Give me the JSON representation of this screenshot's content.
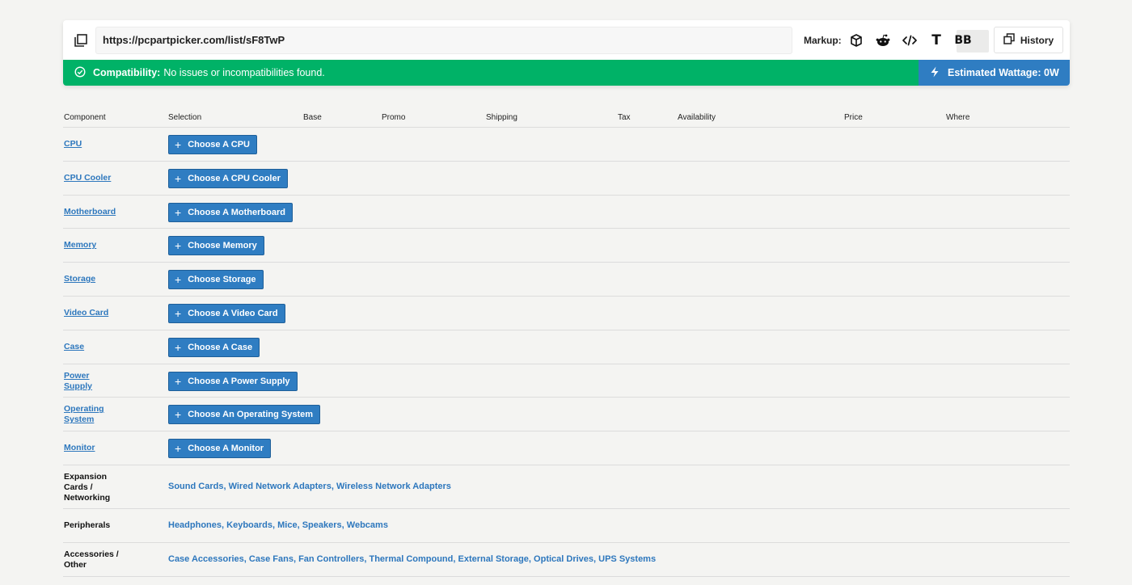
{
  "url": "https://pcpartpicker.com/list/sF8TwP",
  "markup": {
    "label": "Markup:",
    "icons": [
      "cube-icon",
      "reddit-icon",
      "code-icon",
      "text-t-icon",
      "bbcode-icon"
    ],
    "text_icon_glyph": "T",
    "bb_glyph": "BB"
  },
  "history_label": "History",
  "compatibility": {
    "label": "Compatibility:",
    "message": "No issues or incompatibilities found.",
    "color": "#00b267"
  },
  "wattage": {
    "label": "Estimated Wattage: 0W",
    "color": "#2f7dc2"
  },
  "columns": [
    "Component",
    "Selection",
    "Base",
    "Promo",
    "Shipping",
    "Tax",
    "Availability",
    "Price",
    "Where"
  ],
  "components": [
    {
      "name": "CPU",
      "button": "Choose A CPU"
    },
    {
      "name": "CPU Cooler",
      "button": "Choose A CPU Cooler"
    },
    {
      "name": "Motherboard",
      "button": "Choose A Motherboard"
    },
    {
      "name": "Memory",
      "button": "Choose Memory"
    },
    {
      "name": "Storage",
      "button": "Choose Storage"
    },
    {
      "name": "Video Card",
      "button": "Choose A Video Card"
    },
    {
      "name": "Case",
      "button": "Choose A Case"
    },
    {
      "name": "Power Supply",
      "button": "Choose A Power Supply"
    },
    {
      "name": "Operating System",
      "button": "Choose An Operating System"
    },
    {
      "name": "Monitor",
      "button": "Choose A Monitor"
    }
  ],
  "categories": [
    {
      "name": "Expansion Cards / Networking",
      "links": [
        "Sound Cards",
        "Wired Network Adapters",
        "Wireless Network Adapters"
      ]
    },
    {
      "name": "Peripherals",
      "links": [
        "Headphones",
        "Keyboards",
        "Mice",
        "Speakers",
        "Webcams"
      ]
    },
    {
      "name": "Accessories / Other",
      "links": [
        "Case Accessories",
        "Case Fans",
        "Fan Controllers",
        "Thermal Compound",
        "External Storage",
        "Optical Drives",
        "UPS Systems"
      ]
    }
  ]
}
